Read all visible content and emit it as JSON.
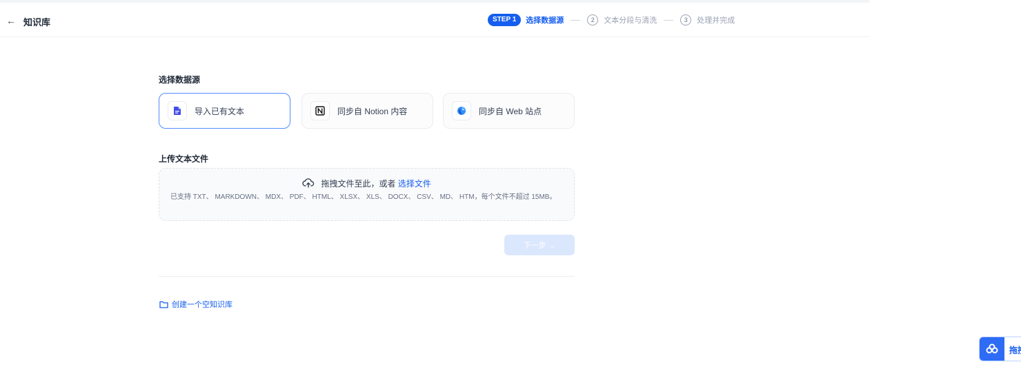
{
  "header": {
    "back_icon": "←",
    "title": "知识库"
  },
  "steps": [
    {
      "badge": "STEP 1",
      "label": "选择数据源",
      "active": true
    },
    {
      "number": "2",
      "label": "文本分段与清洗",
      "active": false
    },
    {
      "number": "3",
      "label": "处理并完成",
      "active": false
    }
  ],
  "source": {
    "heading": "选择数据源",
    "options": [
      {
        "label": "导入已有文本",
        "icon": "file-icon",
        "selected": true
      },
      {
        "label": "同步自 Notion 内容",
        "icon": "notion-icon",
        "selected": false
      },
      {
        "label": "同步自 Web 站点",
        "icon": "globe-icon",
        "selected": false
      }
    ]
  },
  "upload": {
    "heading": "上传文本文件",
    "drag_text": "拖拽文件至此，或者",
    "select_link": "选择文件",
    "hint": "已支持 TXT、 MARKDOWN、 MDX、 PDF、 HTML、 XLSX、 XLS、 DOCX、 CSV、 MD、 HTM，每个文件不超过 15MB。"
  },
  "next_button": {
    "label": "下一步 →",
    "disabled": true
  },
  "empty_kb": {
    "label": "创建一个空知识库",
    "icon": "folder-icon"
  },
  "floating_widget": {
    "label": "拖拽",
    "icon": "cloud-link-icon"
  },
  "colors": {
    "accent": "#155eef",
    "selected_border": "#528bff",
    "disabled_button": "#dbe7fd"
  }
}
